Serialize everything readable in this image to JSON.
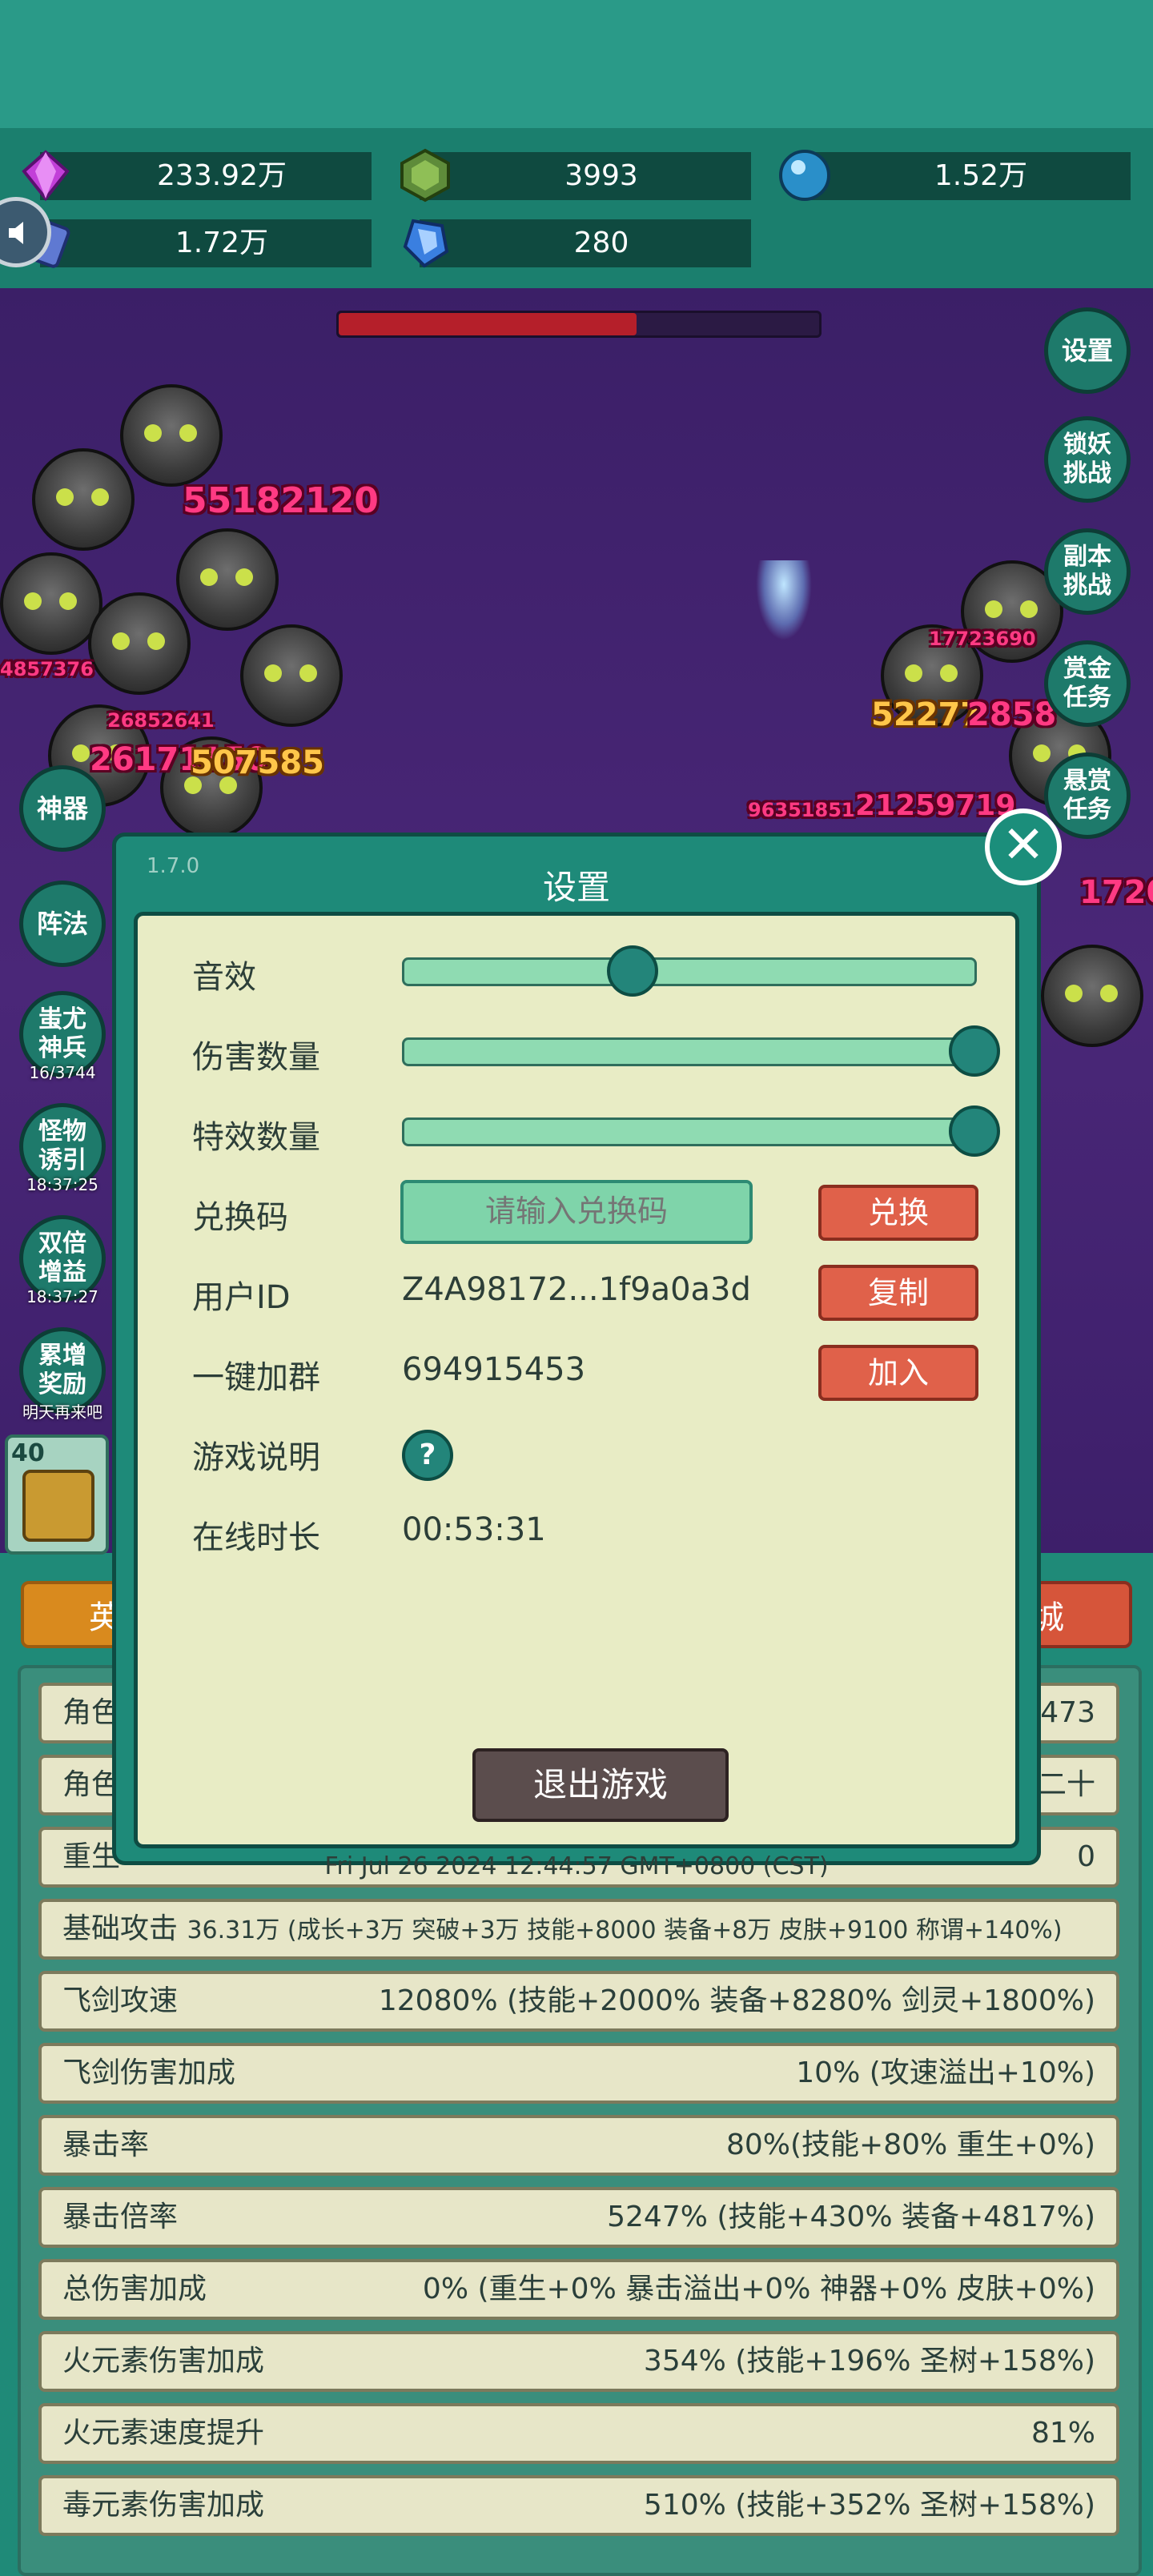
{
  "resources": {
    "crystal": "233.92万",
    "gem_green": "3993",
    "orb": "1.52万",
    "scroll": "1.72万",
    "shard": "280"
  },
  "battle": {
    "damage_numbers": [
      {
        "text": "55182120",
        "style": "pink"
      },
      {
        "text": "26171150",
        "style": "pink"
      },
      {
        "text": "507585",
        "style": "gold"
      },
      {
        "text": "26852641",
        "style": "pink"
      },
      {
        "text": "4857376",
        "style": "pink"
      },
      {
        "text": "52277",
        "style": "gold"
      },
      {
        "text": "2858",
        "style": "pink"
      },
      {
        "text": "21259719",
        "style": "pink"
      },
      {
        "text": "96351851",
        "style": "pink"
      },
      {
        "text": "17723690",
        "style": "pink"
      },
      {
        "text": "1720",
        "style": "pink"
      }
    ],
    "boss_hp_percent": 0.62
  },
  "side_buttons": {
    "settings": "设置",
    "lock_demon": "锁妖挑战",
    "dungeon": "副本挑战",
    "bounty_gold": "赏金任务",
    "bounty_reward": "悬赏任务",
    "artifact": "神器",
    "formation": "阵法",
    "chiyou": "蚩尤神兵",
    "chiyou_sub": "16/3744",
    "monster_lure": "怪物诱引",
    "monster_lure_sub": "18:37:25",
    "double_boost": "双倍增益",
    "double_boost_sub": "18:37:27",
    "accumulate": "累增奖励",
    "accumulate_sub": "明天再来吧"
  },
  "bottom_level": "40",
  "tabs": {
    "left": "英",
    "right": "城"
  },
  "stats": [
    {
      "label": "角色",
      "value": "473"
    },
    {
      "label": "角色",
      "value": "二十"
    },
    {
      "label": "重生",
      "value": "0"
    },
    {
      "label": "基础攻击",
      "extra": "36.31万 (成长+3万 突破+3万 技能+8000 装备+8万 皮肤+9100 称谓+140%)",
      "value": ""
    },
    {
      "label": "飞剑攻速",
      "value": "12080% (技能+2000% 装备+8280% 剑灵+1800%)"
    },
    {
      "label": "飞剑伤害加成",
      "value": "10% (攻速溢出+10%)"
    },
    {
      "label": "暴击率",
      "value": "80%(技能+80% 重生+0%)"
    },
    {
      "label": "暴击倍率",
      "value": "5247% (技能+430% 装备+4817%)"
    },
    {
      "label": "总伤害加成",
      "value": "0% (重生+0% 暴击溢出+0% 神器+0% 皮肤+0%)"
    },
    {
      "label": "火元素伤害加成",
      "value": "354% (技能+196% 圣树+158%)"
    },
    {
      "label": "火元素速度提升",
      "value": "81%"
    },
    {
      "label": "毒元素伤害加成",
      "value": "510% (技能+352% 圣树+158%)"
    }
  ],
  "dialog": {
    "title": "设置",
    "version": "1.7.0",
    "sound_label": "音效",
    "sound_level": 0.4,
    "damage_count_label": "伤害数量",
    "damage_count_level": 1.0,
    "effect_count_label": "特效数量",
    "effect_count_level": 1.0,
    "redeem_label": "兑换码",
    "redeem_placeholder": "请输入兑换码",
    "redeem_button": "兑换",
    "user_id_label": "用户ID",
    "user_id_value": "Z4A98172...1f9a0a3d",
    "copy_button": "复制",
    "group_label": "一键加群",
    "group_value": "694915453",
    "join_button": "加入",
    "help_label": "游戏说明",
    "help_icon": "?",
    "online_label": "在线时长",
    "online_value": "00:53:31",
    "exit_button": "退出游戏",
    "datetime": "Fri Jul 26 2024 12:44:57 GMT+0800 (CST)",
    "close_icon": "✕"
  },
  "colors": {
    "dialog_bg": "#1e8a79",
    "panel_bg": "#e8ecc5",
    "action_red": "#e0614a",
    "slider_fill": "#8fdbb2"
  }
}
